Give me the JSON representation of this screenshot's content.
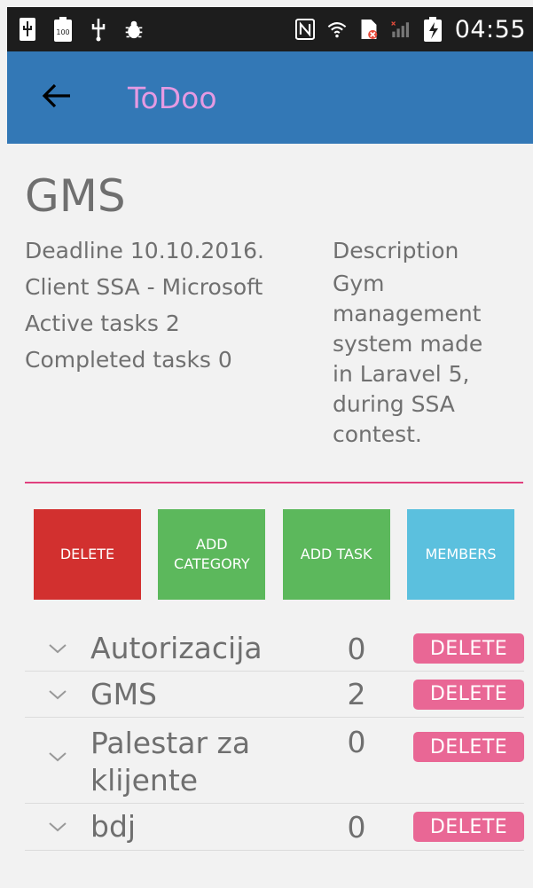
{
  "status_bar": {
    "icons_left": [
      "usb-icon",
      "battery-100-icon",
      "usb-debug-icon",
      "bug-icon"
    ],
    "icons_right": [
      "nfc-icon",
      "wifi-icon",
      "no-sim-icon",
      "signal-icon",
      "charging-icon"
    ],
    "time": "04:55"
  },
  "app_bar": {
    "title": "ToDoo",
    "back_icon": "arrow-left-icon",
    "background": "#3378b6",
    "title_color": "#e59ae2"
  },
  "project": {
    "title": "GMS",
    "deadline": "Deadline 10.10.2016.",
    "client": "Client SSA - Microsoft",
    "active_tasks": "Active tasks 2",
    "completed_tasks": "Completed tasks 0",
    "description_label": "Description",
    "description_lines": [
      "Gym",
      "management",
      "system made",
      "in Laravel 5,",
      "during SSA",
      "contest."
    ]
  },
  "actions": {
    "delete": "DELETE",
    "add_category_line1": "ADD",
    "add_category_line2": "CATEGORY",
    "add_task": "ADD TASK",
    "members": "MEMBERS"
  },
  "categories": [
    {
      "name": "Autorizacija",
      "count": "0",
      "delete": "DELETE"
    },
    {
      "name": "GMS",
      "count": "2",
      "delete": "DELETE"
    },
    {
      "name_line1": "Palestar za",
      "name_line2": "klijente",
      "count": "0",
      "delete": "DELETE"
    },
    {
      "name": "bdj",
      "count": "0",
      "delete": "DELETE"
    }
  ]
}
